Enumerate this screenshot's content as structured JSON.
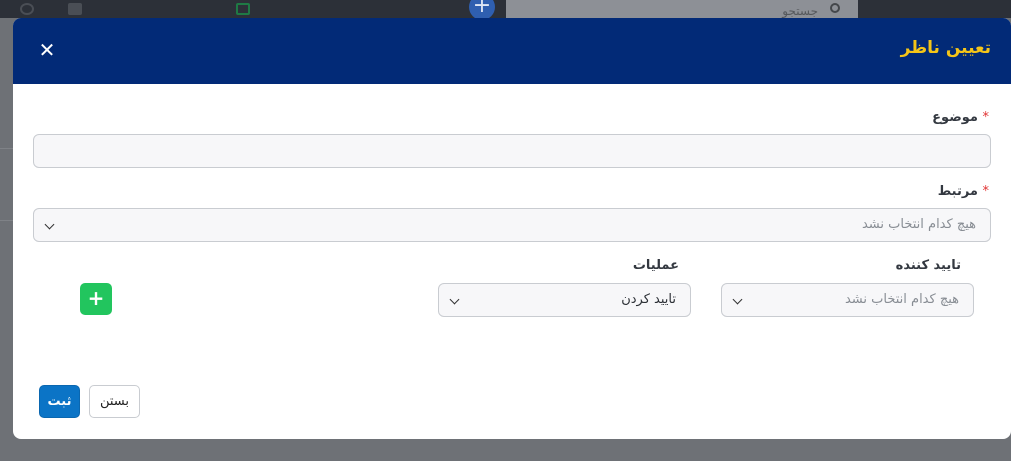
{
  "background": {
    "search_placeholder": "جستجو"
  },
  "modal": {
    "title": "تعیین ناظر",
    "close_symbol": "✕"
  },
  "form": {
    "subject": {
      "label": "موضوع",
      "required_mark": "*",
      "value": ""
    },
    "related": {
      "label": "مرتبط",
      "required_mark": "*",
      "placeholder": "هیچ کدام انتخاب نشد"
    },
    "approver": {
      "label": "تایید کننده",
      "placeholder": "هیچ کدام انتخاب نشد"
    },
    "operations": {
      "label": "عملیات",
      "value": "تایید کردن"
    },
    "add_symbol": "+"
  },
  "footer": {
    "submit_label": "ثبت",
    "close_label": "بستن"
  },
  "colors": {
    "header_bg": "#022a77",
    "title_color": "#f5c518",
    "submit_bg": "#0b74c6",
    "add_bg": "#22c55e"
  },
  "icons": [
    "close-icon",
    "chevron-down-icon",
    "plus-icon",
    "search-icon"
  ]
}
